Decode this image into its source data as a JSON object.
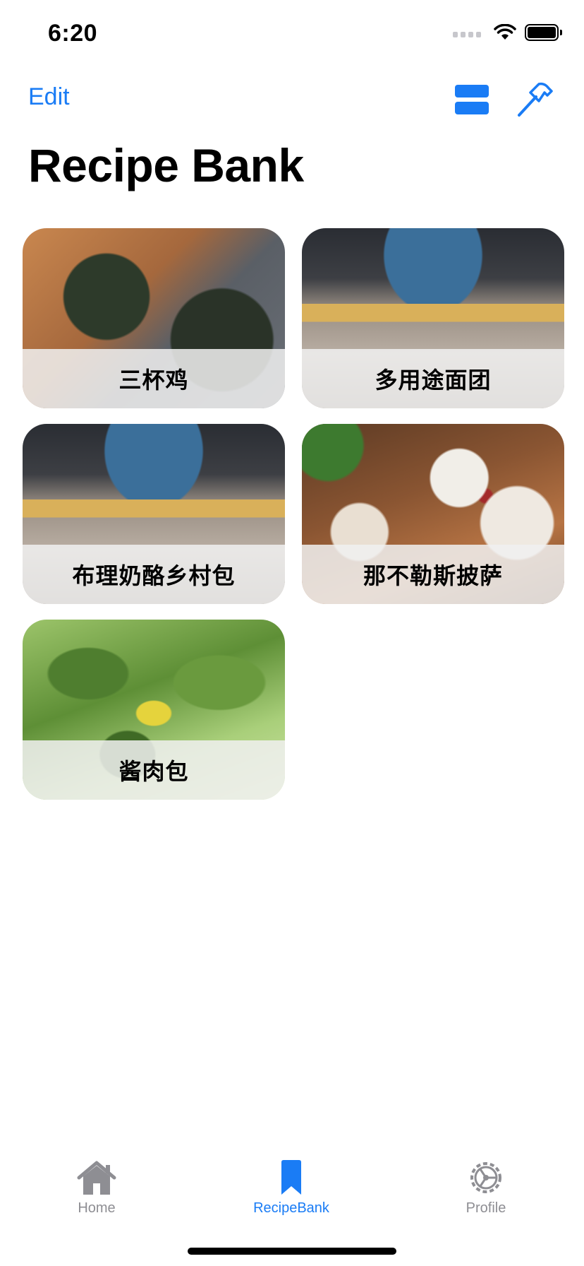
{
  "status_bar": {
    "time": "6:20"
  },
  "nav": {
    "edit_label": "Edit",
    "title": "Recipe Bank",
    "layout_icon": "rectangle-split-icon",
    "tools_icon": "hammer-icon"
  },
  "recipes": [
    {
      "name": "三杯鸡",
      "photo": "noodle-bowls"
    },
    {
      "name": "多用途面团",
      "photo": "rolling-dough"
    },
    {
      "name": "布理奶酪乡村包",
      "photo": "rolling-dough"
    },
    {
      "name": "那不勒斯披萨",
      "photo": "pizza"
    },
    {
      "name": "酱肉包",
      "photo": "green-leaves"
    }
  ],
  "tab_bar": {
    "items": [
      {
        "label": "Home",
        "icon": "house-icon",
        "selected": false
      },
      {
        "label": "RecipeBank",
        "icon": "bookmark-icon",
        "selected": true
      },
      {
        "label": "Profile",
        "icon": "gear-icon",
        "selected": false
      }
    ]
  },
  "colors": {
    "accent": "#1a7cf5",
    "inactive": "#8e8e93"
  }
}
